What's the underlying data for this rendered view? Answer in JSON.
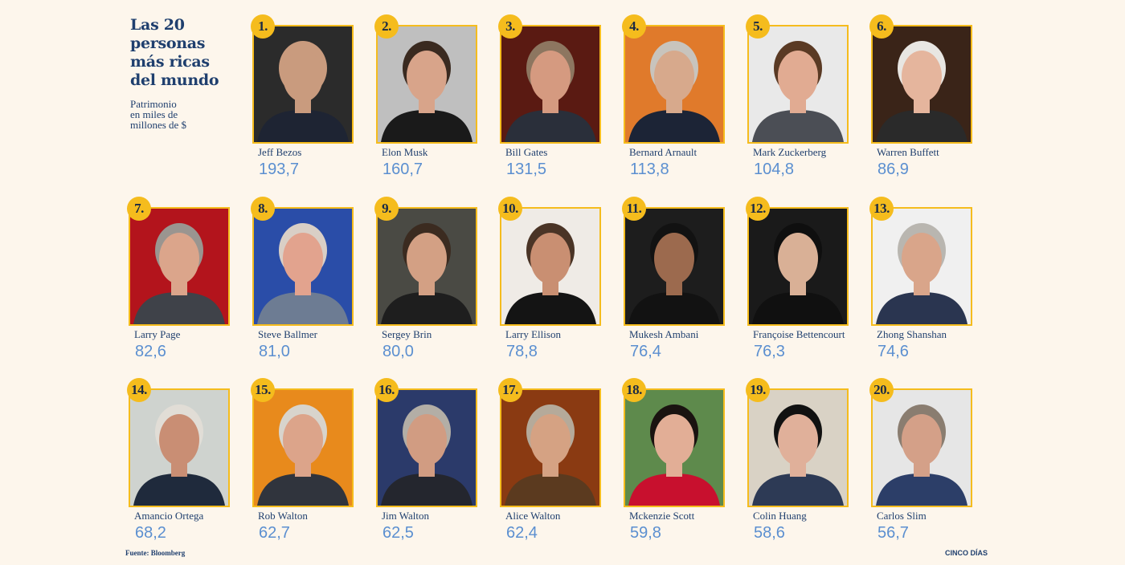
{
  "header": {
    "title": "Las 20\npersonas\nmás ricas\ndel mundo",
    "subtitle": "Patrimonio\nen miles de\nmillones de $"
  },
  "people": [
    {
      "rank": "1.",
      "name": "Jeff Bezos",
      "value": "193,7",
      "bg": "#2b2b2b",
      "skin": "#c99b7e",
      "hair": "#c99b7e",
      "suit": "#1e2433"
    },
    {
      "rank": "2.",
      "name": "Elon Musk",
      "value": "160,7",
      "bg": "#bfbfbf",
      "skin": "#d8a48a",
      "hair": "#3a2a20",
      "suit": "#1a1a1a"
    },
    {
      "rank": "3.",
      "name": "Bill Gates",
      "value": "131,5",
      "bg": "#5a1a12",
      "skin": "#d59a80",
      "hair": "#8d7660",
      "suit": "#2a2f3a"
    },
    {
      "rank": "4.",
      "name": "Bernard Arnault",
      "value": "113,8",
      "bg": "#e07a2b",
      "skin": "#d7a98c",
      "hair": "#c8c4bd",
      "suit": "#1c2436"
    },
    {
      "rank": "5.",
      "name": "Mark Zuckerberg",
      "value": "104,8",
      "bg": "#e9e9e9",
      "skin": "#e1ab92",
      "hair": "#5a3a24",
      "suit": "#4b4e55"
    },
    {
      "rank": "6.",
      "name": "Warren Buffett",
      "value": "86,9",
      "bg": "#3a2418",
      "skin": "#e5b59d",
      "hair": "#e8e6e2",
      "suit": "#2a2a2a"
    },
    {
      "rank": "7.",
      "name": "Larry Page",
      "value": "82,6",
      "bg": "#b3141c",
      "skin": "#dba58b",
      "hair": "#9a9590",
      "suit": "#3f4249"
    },
    {
      "rank": "8.",
      "name": "Steve Ballmer",
      "value": "81,0",
      "bg": "#2a4da8",
      "skin": "#e2a38e",
      "hair": "#d9cfc6",
      "suit": "#6d7c93"
    },
    {
      "rank": "9.",
      "name": "Sergey Brin",
      "value": "80,0",
      "bg": "#4a4a44",
      "skin": "#d3a084",
      "hair": "#3b2b20",
      "suit": "#1e1e1e"
    },
    {
      "rank": "10.",
      "name": "Larry Ellison",
      "value": "78,8",
      "bg": "#efebe6",
      "skin": "#c98f72",
      "hair": "#4a3426",
      "suit": "#141414"
    },
    {
      "rank": "11.",
      "name": "Mukesh Ambani",
      "value": "76,4",
      "bg": "#1d1d1d",
      "skin": "#9c6a4e",
      "hair": "#121212",
      "suit": "#121212"
    },
    {
      "rank": "12.",
      "name": "Françoise Bettencourt",
      "value": "76,3",
      "bg": "#1a1a1a",
      "skin": "#d9b096",
      "hair": "#0f0f0f",
      "suit": "#101010"
    },
    {
      "rank": "13.",
      "name": "Zhong Shanshan",
      "value": "74,6",
      "bg": "#f0f0f0",
      "skin": "#d9a58a",
      "hair": "#b9b6b0",
      "suit": "#2a3550"
    },
    {
      "rank": "14.",
      "name": "Amancio Ortega",
      "value": "68,2",
      "bg": "#cfd3cf",
      "skin": "#c98e74",
      "hair": "#e1ddd6",
      "suit": "#1f2a3c"
    },
    {
      "rank": "15.",
      "name": "Rob Walton",
      "value": "62,7",
      "bg": "#e88a1c",
      "skin": "#dca48a",
      "hair": "#d8d4cc",
      "suit": "#30343d"
    },
    {
      "rank": "16.",
      "name": "Jim Walton",
      "value": "62,5",
      "bg": "#2b3a6a",
      "skin": "#d19c82",
      "hair": "#b3aea6",
      "suit": "#24262e"
    },
    {
      "rank": "17.",
      "name": "Alice Walton",
      "value": "62,4",
      "bg": "#8a3a12",
      "skin": "#d5a283",
      "hair": "#b5aa9a",
      "suit": "#5b3a1f"
    },
    {
      "rank": "18.",
      "name": "Mckenzie Scott",
      "value": "59,8",
      "bg": "#5e8a4c",
      "skin": "#e2ae96",
      "hair": "#1a1310",
      "suit": "#c8102e"
    },
    {
      "rank": "19.",
      "name": "Colin Huang",
      "value": "58,6",
      "bg": "#d9d2c5",
      "skin": "#e0b09a",
      "hair": "#111111",
      "suit": "#2d3a55"
    },
    {
      "rank": "20.",
      "name": "Carlos Slim",
      "value": "56,7",
      "bg": "#e6e6e6",
      "skin": "#d4a088",
      "hair": "#8a7d70",
      "suit": "#2c3e68"
    }
  ],
  "footer": {
    "source": "Fuente: Bloomberg",
    "brand": "CINCO DÍAS"
  },
  "colors": {
    "background": "#fdf6ec",
    "accent": "#f5bc1d",
    "navy": "#1f3f6e",
    "value_blue": "#5b8fd0"
  }
}
